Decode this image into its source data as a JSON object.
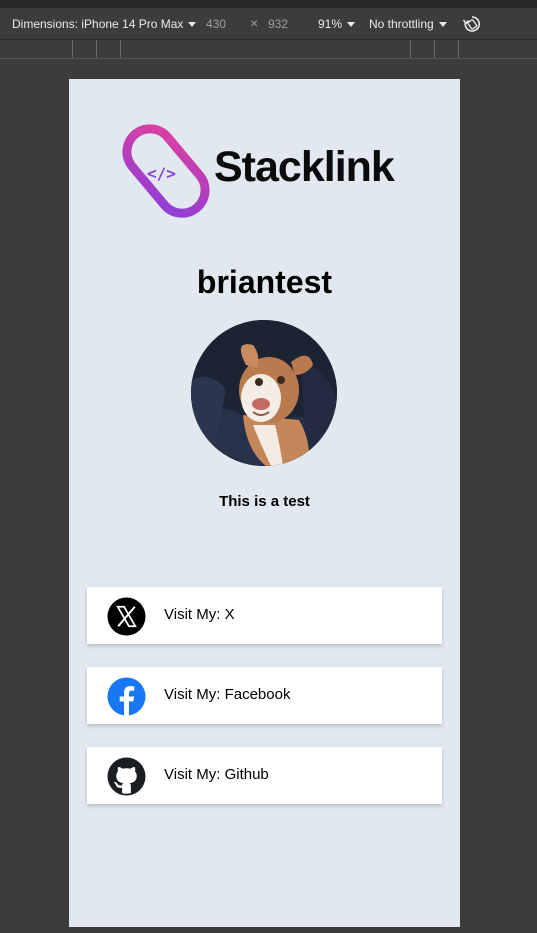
{
  "devtools": {
    "dimensions_label": "Dimensions: iPhone 14 Pro Max",
    "width": "430",
    "times": "×",
    "height": "932",
    "zoom": "91%",
    "throttling": "No throttling",
    "rotate_icon": "rotate-icon"
  },
  "page": {
    "logo_text": "Stacklink",
    "username": "briantest",
    "bio": "This is a test",
    "brand_gradient": [
      "#e040a0",
      "#7c3aed"
    ],
    "background": "#e2e8f0"
  },
  "links": [
    {
      "label": "Visit My: X",
      "icon": "x-icon"
    },
    {
      "label": "Visit My: Facebook",
      "icon": "facebook-icon"
    },
    {
      "label": "Visit My: Github",
      "icon": "github-icon"
    }
  ]
}
